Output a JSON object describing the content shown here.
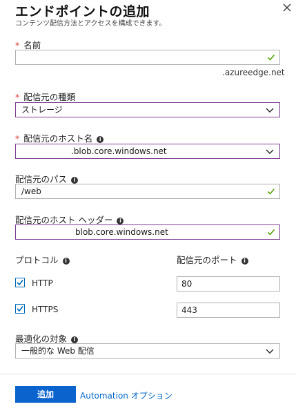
{
  "header": {
    "title": "エンドポイントの追加",
    "subtitle": "コンテンツ配信方法とアクセスを構成できます。"
  },
  "fields": {
    "name": {
      "label": "名前",
      "required_mark": "*",
      "value": "",
      "suffix": ".azureedge.net"
    },
    "origin_type": {
      "label": "配信元の種類",
      "required_mark": "*",
      "value": "ストレージ"
    },
    "origin_hostname": {
      "label": "配信元のホスト名",
      "required_mark": "*",
      "value": ".blob.core.windows.net"
    },
    "origin_path": {
      "label": "配信元のパス",
      "value": "/web"
    },
    "origin_host_header": {
      "label": "配信元のホスト ヘッダー",
      "value": "blob.core.windows.net"
    },
    "optimization": {
      "label": "最適化の対象",
      "value": "一般的な Web 配信"
    }
  },
  "protocol": {
    "label": "プロトコル",
    "http": {
      "label": "HTTP",
      "checked": true
    },
    "https": {
      "label": "HTTPS",
      "checked": true
    }
  },
  "ports": {
    "label": "配信元のポート",
    "http": "80",
    "https": "443"
  },
  "footer": {
    "add_label": "追加",
    "automation_label": "Automation オプション"
  },
  "info_glyph": "i",
  "colors": {
    "accent": "#0b63ce",
    "link": "#0066cc",
    "focus_border": "#7c3c93",
    "check_green": "#57a300",
    "required": "#e0403b"
  }
}
